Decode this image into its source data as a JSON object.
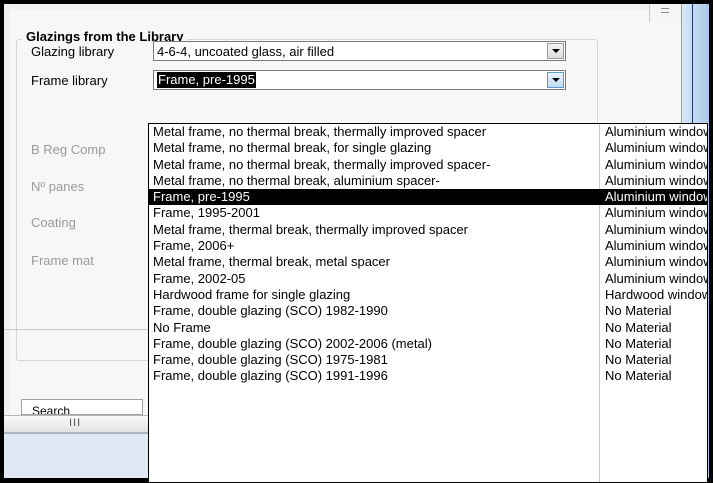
{
  "group_title": "Glazings from the Library",
  "glazing_library": {
    "label": "Glazing library",
    "value": "4-6-4, uncoated glass, air filled"
  },
  "frame_library": {
    "label": "Frame library",
    "value": "Frame, pre-1995"
  },
  "hidden_labels": [
    "B Reg Comp",
    "Nº panes",
    "Coating",
    "Frame mat"
  ],
  "search_label": "Search",
  "grip": "III",
  "dropdown_items": [
    {
      "name": "Metal frame, no thermal break, thermally improved spacer",
      "material": "Aluminium window"
    },
    {
      "name": "Metal frame, no thermal break, for single glazing",
      "material": "Aluminium window"
    },
    {
      "name": "Metal frame, no thermal break, thermally improved spacer-",
      "material": "Aluminium window"
    },
    {
      "name": "Metal frame, no thermal break, aluminium spacer-",
      "material": "Aluminium window"
    },
    {
      "name": "Frame, pre-1995",
      "material": "Aluminium window",
      "selected": true
    },
    {
      "name": "Frame, 1995-2001",
      "material": "Aluminium window"
    },
    {
      "name": "Metal frame, thermal break, thermally improved spacer",
      "material": "Aluminium window"
    },
    {
      "name": "Frame, 2006+",
      "material": "Aluminium window"
    },
    {
      "name": "Metal frame, thermal break, metal spacer",
      "material": "Aluminium window"
    },
    {
      "name": "Frame, 2002-05",
      "material": "Aluminium window"
    },
    {
      "name": "Hardwood frame for single glazing",
      "material": "Hardwood window"
    },
    {
      "name": "Frame, double glazing (SCO) 1982-1990",
      "material": "No Material"
    },
    {
      "name": "No Frame",
      "material": "No Material"
    },
    {
      "name": "Frame, double glazing (SCO) 2002-2006 (metal)",
      "material": "No Material"
    },
    {
      "name": "Frame, double glazing (SCO) 1975-1981",
      "material": "No Material"
    },
    {
      "name": "Frame, double glazing (SCO) 1991-1996",
      "material": "No Material"
    }
  ],
  "colors": {
    "selection": "#000000",
    "list_bg": "#ffffff",
    "panel": "#f7f7f7",
    "dim_text": "#9a9a9a"
  }
}
